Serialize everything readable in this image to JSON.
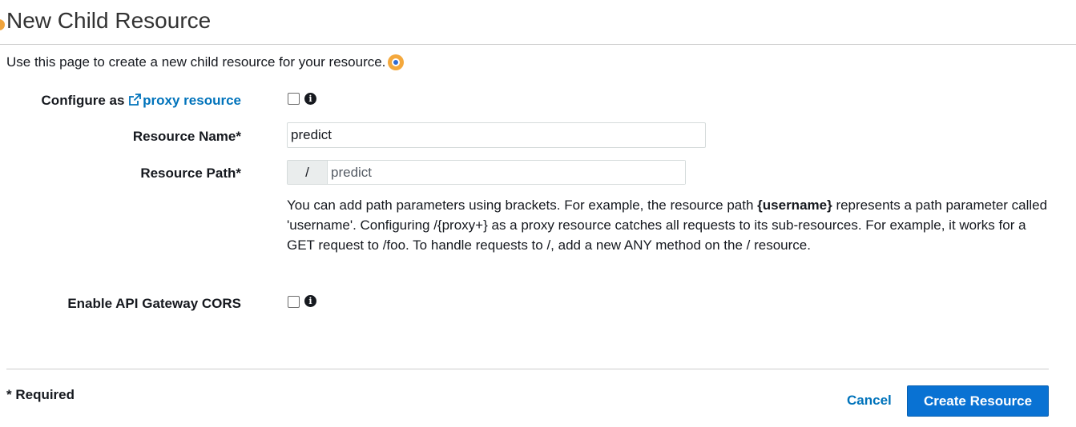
{
  "page": {
    "title": "New Child Resource",
    "intro": "Use this page to create a new child resource for your resource."
  },
  "form": {
    "proxy": {
      "label_prefix": "Configure as ",
      "link_text": "proxy resource",
      "checked": false
    },
    "resource_name": {
      "label": "Resource Name*",
      "value": "predict"
    },
    "resource_path": {
      "label": "Resource Path*",
      "prefix": "/",
      "value": "predict"
    },
    "help": {
      "part1": "You can add path parameters using brackets. For example, the resource path ",
      "emphasis": "{username}",
      "part2": " represents a path parameter called 'username'. Configuring /{proxy+} as a proxy resource catches all requests to its sub-resources. For example, it works for a GET request to /foo. To handle requests to /, add a new ANY method on the / resource."
    },
    "cors": {
      "label": "Enable API Gateway CORS",
      "checked": false
    }
  },
  "footer": {
    "required_note": "* Required",
    "cancel_label": "Cancel",
    "create_label": "Create Resource"
  },
  "icons": {
    "info": "info-icon",
    "external_link": "external-link-icon",
    "help_indicator": "info-dot-icon"
  },
  "colors": {
    "link": "#0073bb",
    "primary_button": "#0972d3",
    "accent_orange": "#f4a83c"
  }
}
